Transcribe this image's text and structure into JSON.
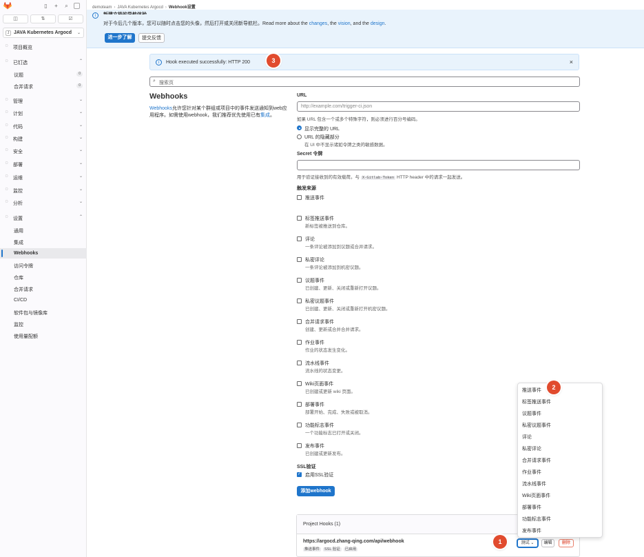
{
  "sidebar": {
    "topbar_icons": [
      "sidebar-toggle-icon",
      "plus-icon",
      "search-icon",
      "avatar-icon"
    ],
    "tabs": [
      "issues-icon",
      "merge-request-icon",
      "todo-icon"
    ],
    "project": {
      "avatar": "J",
      "name": "JAVA Kubernetes Argocd"
    },
    "items": [
      {
        "label": "项目概览",
        "icon": "project-icon",
        "chev": ""
      },
      {
        "label": "已钉选",
        "icon": "pin-icon",
        "chev": "⌃"
      },
      {
        "label": "管理",
        "icon": "briefcase-icon",
        "chev": "⌄"
      },
      {
        "label": "计划",
        "icon": "plan-icon",
        "chev": "⌄"
      },
      {
        "label": "代码",
        "icon": "code-icon",
        "chev": "⌄"
      },
      {
        "label": "构建",
        "icon": "rocket-icon",
        "chev": "⌄"
      },
      {
        "label": "安全",
        "icon": "shield-icon",
        "chev": "⌄"
      },
      {
        "label": "部署",
        "icon": "deploy-icon",
        "chev": "⌄"
      },
      {
        "label": "运维",
        "icon": "cloud-icon",
        "chev": "⌄"
      },
      {
        "label": "监控",
        "icon": "monitor-icon",
        "chev": "⌄"
      },
      {
        "label": "分析",
        "icon": "chart-icon",
        "chev": "⌄"
      },
      {
        "label": "设置",
        "icon": "settings-icon",
        "chev": "⌃"
      }
    ],
    "pinned": [
      {
        "label": "议题",
        "count": "0"
      },
      {
        "label": "合并请求",
        "count": "0"
      }
    ],
    "settings_sub": [
      "通用",
      "集成",
      "Webhooks",
      "访问令牌",
      "仓库",
      "合并请求",
      "CI/CD",
      "软件包与镜像库",
      "监控",
      "使用量配额"
    ]
  },
  "breadcrumb": [
    "demoteam",
    "JAVA Kubernetes Argocd",
    "Webhook设置"
  ],
  "callout": {
    "title": "新建文档的导航体验",
    "text_prefix": "对于今后几个版本，您可以随时点击您的头像，然后打开或关闭新导航栏。Read more about the",
    "link1": "changes",
    "mid1": ", the",
    "link2": "vision",
    "mid2": ", and the",
    "link3": "design",
    "end": ".",
    "learn_more": "进一步了解",
    "feedback": "提交反馈"
  },
  "alert": {
    "text": "Hook executed successfully: HTTP 200",
    "close": "×"
  },
  "search": {
    "placeholder": "搜索页"
  },
  "webhooks": {
    "title": "Webhooks",
    "desc_link": "Webhooks",
    "desc": "允许您针对某个群组或项目中的事件发送通知到web应用程序。如需使用webhook，我们推荐优先使用已有",
    "desc_link2": "集成",
    "desc_end": "。"
  },
  "form": {
    "url_label": "URL",
    "url_placeholder": "http://example.com/trigger-ci.json",
    "url_help": "如果 URL 包含一个或多个特殊字符，则必须进行百分号编码。",
    "radio1": "显示完整的 URL",
    "radio2": "URL 的隐藏部分",
    "radio2_desc": "在 UI 中不显示诸如令牌之类的敏感数据。",
    "secret_label": "Secret 令牌",
    "secret_help_prefix": "用于验证接收到的有效载荷。与",
    "secret_help_code": "X-Gitlab-Token",
    "secret_help_suffix": "HTTP header 中的请求一起发送。",
    "triggers_label": "触发来源",
    "triggers": [
      {
        "label": "推送事件",
        "desc": ""
      },
      {
        "label": "标签推送事件",
        "desc": "新标签被推送到仓库。"
      },
      {
        "label": "评论",
        "desc": "一条评论被添加到议题或合并请求。"
      },
      {
        "label": "私密评论",
        "desc": "一条评论被添加到机密议题。"
      },
      {
        "label": "议题事件",
        "desc": "已创建、更新、关闭或重新打开议题。"
      },
      {
        "label": "私密议题事件",
        "desc": "已创建、更新、关闭或重新打开机密议题。"
      },
      {
        "label": "合并请求事件",
        "desc": "创建、更新或合并合并请求。"
      },
      {
        "label": "作业事件",
        "desc": "作业的状态发生变化。"
      },
      {
        "label": "流水线事件",
        "desc": "流水线的状态变更。"
      },
      {
        "label": "Wiki页面事件",
        "desc": "已创建或更新 wiki 页面。"
      },
      {
        "label": "部署事件",
        "desc": "部署开始、完成、失败或被取消。"
      },
      {
        "label": "功能标志事件",
        "desc": "一个功能标志已打开或关闭。"
      },
      {
        "label": "发布事件",
        "desc": "已创建或更新发布。"
      }
    ],
    "ssl_label": "SSL验证",
    "ssl_checkbox": "启用SSL验证",
    "add_button": "添加webhook"
  },
  "project_hooks": {
    "title": "Project Hooks (1)",
    "url": "https://argocd.zhang-qing.com/api/webhook",
    "tags": [
      "推送事件",
      "SSL 验证",
      "已启用"
    ],
    "test_button": "测试",
    "edit_button": "编辑",
    "delete_button": "删除"
  },
  "dropdown": {
    "items": [
      "推送事件",
      "标签推送事件",
      "议题事件",
      "私密议题事件",
      "评论",
      "私密评论",
      "合并请求事件",
      "作业事件",
      "流水线事件",
      "Wiki页面事件",
      "部署事件",
      "功能标志事件",
      "发布事件"
    ]
  },
  "annotations": [
    "1",
    "2",
    "3"
  ],
  "colors": {
    "primary": "#1f75cb",
    "danger": "#dd2b0e",
    "badge": "#e14b2e",
    "callout_bg": "#e9f3fc"
  }
}
